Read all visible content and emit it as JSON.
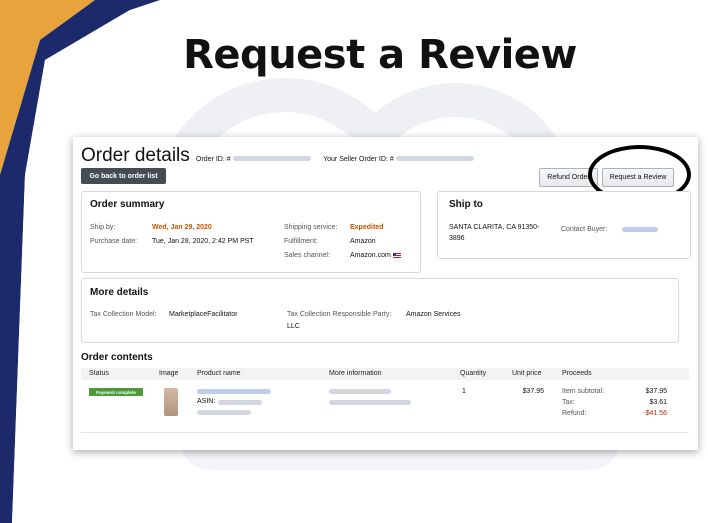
{
  "slide": {
    "title": "Request a Review",
    "colors": {
      "accent_orange": "#E8A33C",
      "accent_navy": "#1C2A6B",
      "watermark": "#EEF0F4"
    }
  },
  "order": {
    "heading": "Order details",
    "order_id_label": "Order ID: #",
    "seller_order_id_label": "Your Seller Order ID: #",
    "back_button": "Go back to order list",
    "refund_button": "Refund Order",
    "request_review_button": "Request a Review",
    "summary": {
      "title": "Order summary",
      "ship_by_label": "Ship by:",
      "ship_by_value": "Wed, Jan 29, 2020",
      "purchase_date_label": "Purchase date:",
      "purchase_date_value": "Tue, Jan 28, 2020, 2:42 PM PST",
      "shipping_service_label": "Shipping service:",
      "shipping_service_value": "Expedited",
      "fulfillment_label": "Fulfillment:",
      "fulfillment_value": "Amazon",
      "sales_channel_label": "Sales channel:",
      "sales_channel_value": "Amazon.com"
    },
    "ship_to": {
      "title": "Ship to",
      "address_line1": "SANTA CLARITA, CA 91350-",
      "address_line2": "3896",
      "contact_label": "Contact Buyer:"
    },
    "more_details": {
      "title": "More details",
      "tax_model_label": "Tax Collection Model:",
      "tax_model_value": "MarketplaceFacilitator",
      "tax_party_label": "Tax Collection Responsible Party:",
      "tax_party_value_line1": "Amazon Services",
      "tax_party_value_line2": "LLC"
    },
    "contents": {
      "title": "Order contents",
      "columns": [
        "Status",
        "Image",
        "Product name",
        "More information",
        "Quantity",
        "Unit price",
        "Proceeds"
      ],
      "row": {
        "status": "Payment complete",
        "asin_label": "ASIN:",
        "quantity": "1",
        "unit_price": "$37.95",
        "item_subtotal_label": "Item subtotal:",
        "item_subtotal_value": "$37.95",
        "tax_label": "Tax:",
        "tax_value": "$3.61",
        "refund_label": "Refund:",
        "refund_value": "-$41.56"
      }
    }
  }
}
